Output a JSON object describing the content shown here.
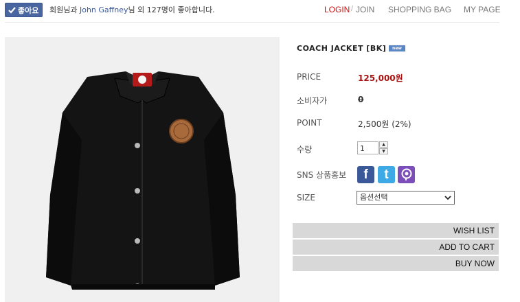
{
  "facebook": {
    "like_label": "좋아요",
    "text_prefix": "회원님과",
    "friend_name": "John Gaffney",
    "text_suffix": "님 외 127명이 좋아합니다."
  },
  "topnav": {
    "login": "LOGIN",
    "separator": "/",
    "join": "JOIN",
    "shopping_bag": "SHOPPING BAG",
    "my_page": "MY PAGE"
  },
  "product": {
    "title": "COACH JACKET [BK]",
    "badge": "new",
    "price_label": "PRICE",
    "price_value": "125,000원",
    "consumer_label": "소비자가",
    "consumer_value": "0",
    "point_label": "POINT",
    "point_value": "2,500원 (2%)",
    "quantity_label": "수량",
    "quantity_value": "1",
    "sns_label": "SNS 상품홍보",
    "size_label": "SIZE",
    "size_selected": "옵션선택"
  },
  "actions": {
    "wish_list": "WISH LIST",
    "add_to_cart": "ADD TO CART",
    "buy_now": "BUY NOW"
  },
  "icons": {
    "facebook": "facebook-icon",
    "twitter": "twitter-icon",
    "kakaostory": "kakaostory-icon"
  },
  "colors": {
    "accent_red": "#cc1111",
    "price_red": "#aa1111",
    "facebook_blue": "#3b5998",
    "twitter_blue": "#3fa9e5",
    "kakaostory_purple": "#7c4fb8",
    "button_gray": "#d8d8d8"
  }
}
